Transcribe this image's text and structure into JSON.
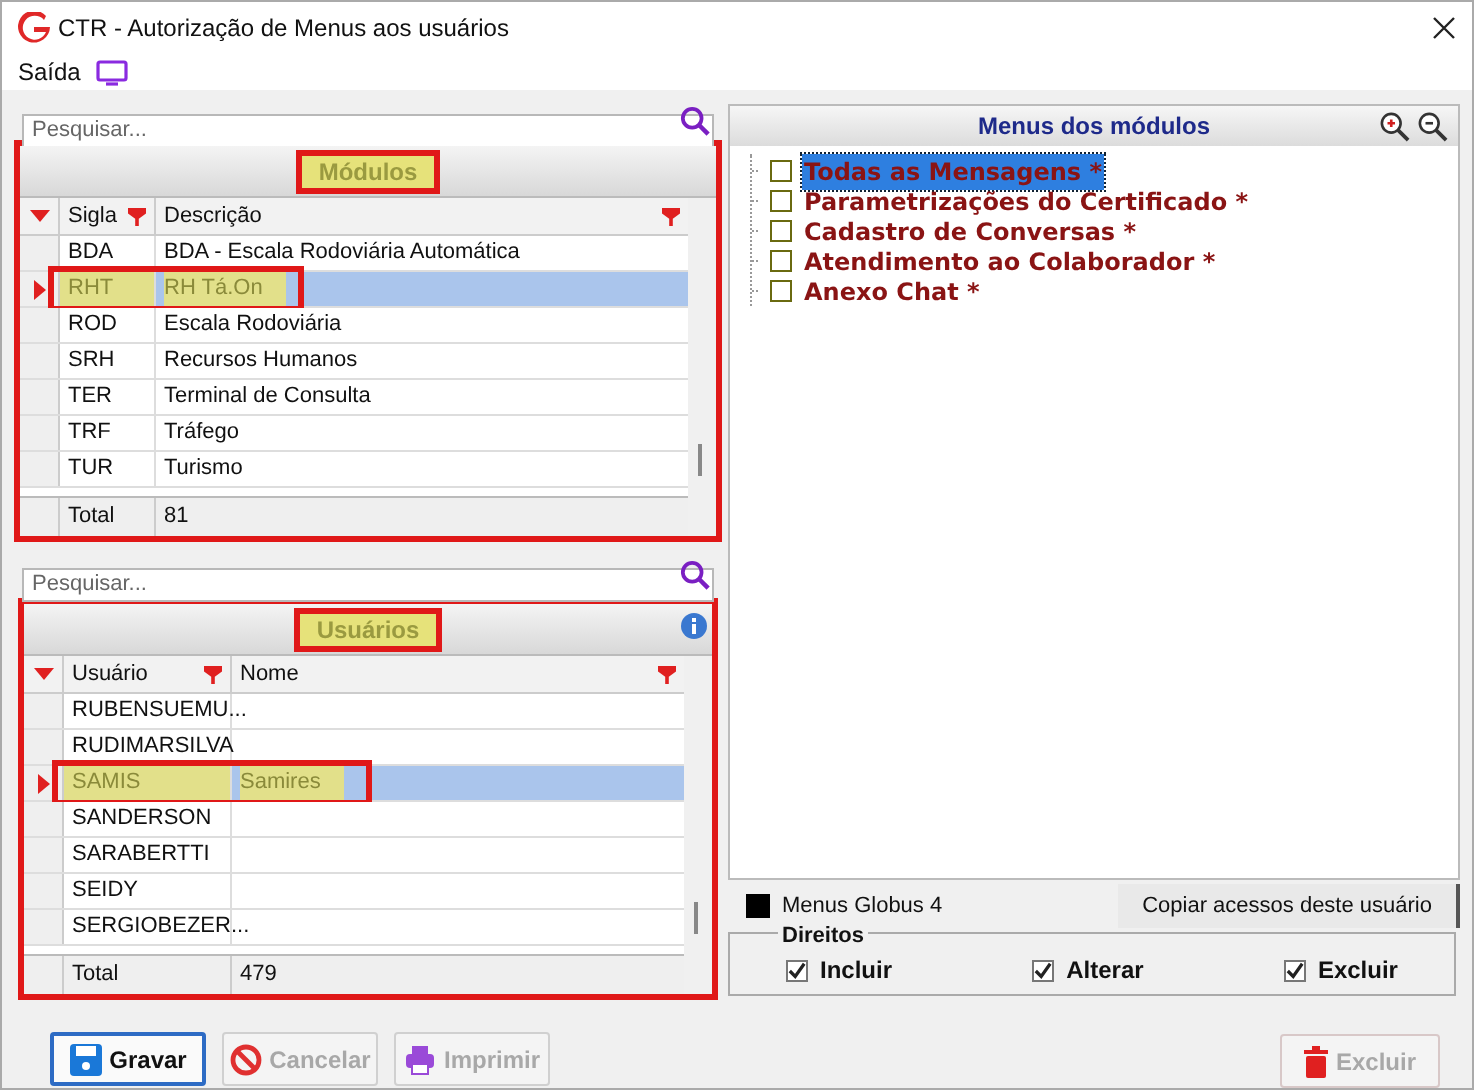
{
  "window": {
    "title": "CTR - Autorização de Menus aos usuários"
  },
  "menu": [
    {
      "label": "Saída"
    }
  ],
  "modules": {
    "search_placeholder": "Pesquisar...",
    "title": "Módulos",
    "columns": [
      "Sigla",
      "Descrição"
    ],
    "rows": [
      {
        "sigla": "BDA",
        "descricao": "BDA - Escala Rodoviária Automática",
        "selected": false
      },
      {
        "sigla": "RHT",
        "descricao": "RH Tá.On",
        "selected": true
      },
      {
        "sigla": "ROD",
        "descricao": "Escala Rodoviária",
        "selected": false
      },
      {
        "sigla": "SRH",
        "descricao": "Recursos Humanos",
        "selected": false
      },
      {
        "sigla": "TER",
        "descricao": "Terminal de Consulta",
        "selected": false
      },
      {
        "sigla": "TRF",
        "descricao": "Tráfego",
        "selected": false
      },
      {
        "sigla": "TUR",
        "descricao": "Turismo",
        "selected": false
      }
    ],
    "total_label": "Total",
    "total_value": "81"
  },
  "users": {
    "search_placeholder": "Pesquisar...",
    "title": "Usuários",
    "columns": [
      "Usuário",
      "Nome"
    ],
    "rows": [
      {
        "usuario": "RUBENSUEMU...",
        "nome": "",
        "selected": false
      },
      {
        "usuario": "RUDIMARSILVA",
        "nome": "",
        "selected": false
      },
      {
        "usuario": "SAMIS",
        "nome": "Samires",
        "selected": true
      },
      {
        "usuario": "SANDERSON",
        "nome": "",
        "selected": false
      },
      {
        "usuario": "SARABERTTI",
        "nome": "",
        "selected": false
      },
      {
        "usuario": "SEIDY",
        "nome": "",
        "selected": false
      },
      {
        "usuario": "SERGIOBEZER...",
        "nome": "",
        "selected": false
      }
    ],
    "total_label": "Total",
    "total_value": "479"
  },
  "menus_panel": {
    "title": "Menus dos módulos",
    "items": [
      {
        "label": "Todas as Mensagens *",
        "checked": false,
        "selected": true
      },
      {
        "label": "Parametrizações do Certificado *",
        "checked": false,
        "selected": false
      },
      {
        "label": "Cadastro de Conversas *",
        "checked": false,
        "selected": false
      },
      {
        "label": "Atendimento ao Colaborador *",
        "checked": false,
        "selected": false
      },
      {
        "label": "Anexo Chat *",
        "checked": false,
        "selected": false
      }
    ]
  },
  "legend": {
    "label": "Menus Globus 4"
  },
  "copy_button": {
    "label": "Copiar acessos deste usuário"
  },
  "rights": {
    "title": "Direitos",
    "options": [
      {
        "label": "Incluir",
        "checked": true
      },
      {
        "label": "Alterar",
        "checked": true
      },
      {
        "label": "Excluir",
        "checked": true
      }
    ]
  },
  "buttons": [
    {
      "kind": "save",
      "label": "Gravar",
      "disabled": false
    },
    {
      "kind": "cancel",
      "label": "Cancelar",
      "disabled": true
    },
    {
      "kind": "print",
      "label": "Imprimir",
      "disabled": true
    }
  ],
  "delete_button": {
    "label": "Excluir",
    "disabled": true
  }
}
